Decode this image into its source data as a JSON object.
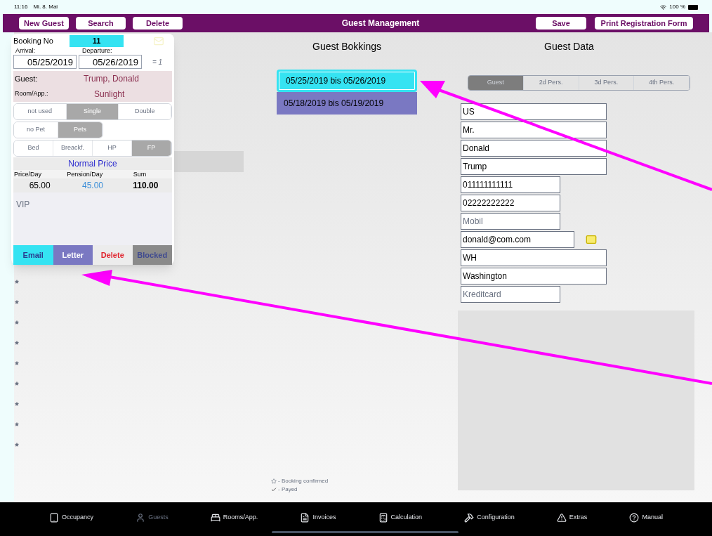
{
  "status_bar": {
    "time": "11:16",
    "date": "Mi. 8. Mai",
    "battery": "100 %"
  },
  "toolbar": {
    "title": "Guest Management",
    "left_buttons": [
      "New Guest",
      "Search",
      "Delete"
    ],
    "right_buttons": [
      "Save",
      "Print Registration Form"
    ]
  },
  "booking_card": {
    "booking_no_label": "Booking No",
    "booking_no": "11",
    "arrival_label": "Arrival:",
    "departure_label": "Departure:",
    "arrival": "05/25/2019",
    "departure": "05/26/2019",
    "nights": "= 1",
    "guest_label": "Guest:",
    "guest": "Trump, Donald",
    "room_label": "Room/App.:",
    "room": "Sunlight",
    "occupancy": [
      {
        "label": "not used",
        "selected": false
      },
      {
        "label": "Single",
        "selected": true
      },
      {
        "label": "Double",
        "selected": false
      }
    ],
    "pets": [
      {
        "label": "no Pet",
        "selected": false
      },
      {
        "label": "Pets",
        "selected": true
      }
    ],
    "board": [
      {
        "label": "Bed",
        "selected": false
      },
      {
        "label": "Breackf.",
        "selected": false
      },
      {
        "label": "HP",
        "selected": false
      },
      {
        "label": "FP",
        "selected": true
      }
    ],
    "price_type": "Normal Price",
    "price_labels": [
      "Price/Day",
      "Pension/Day",
      "Sum"
    ],
    "prices": [
      "65.00",
      "45.00",
      "110.00"
    ],
    "note": "VIP",
    "actions": [
      {
        "label": "Email",
        "kind": "email"
      },
      {
        "label": "Letter",
        "kind": "letter"
      },
      {
        "label": "Delete",
        "kind": "delete"
      },
      {
        "label": "Blocked",
        "kind": "blocked"
      }
    ]
  },
  "legend": [
    {
      "kind": "star",
      "text": "- Booking confirmed"
    },
    {
      "kind": "check",
      "text": "- Payed"
    }
  ],
  "bookings": {
    "title": "Guest Bokkings",
    "items": [
      {
        "label": "05/25/2019  bis  05/26/2019",
        "selected": true
      },
      {
        "label": "05/18/2019  bis  05/19/2019",
        "selected": false
      }
    ]
  },
  "guest_data": {
    "title": "Guest Data",
    "person_tabs": [
      {
        "label": "Guest",
        "selected": true
      },
      {
        "label": "2d Pers.",
        "selected": false
      },
      {
        "label": "3d Pers.",
        "selected": false
      },
      {
        "label": "4th Pers.",
        "selected": false
      }
    ],
    "fields": [
      {
        "value": "US",
        "kind": "wide"
      },
      {
        "value": "Mr.",
        "kind": "wide"
      },
      {
        "value": "Donald",
        "kind": "wide"
      },
      {
        "value": "Trump",
        "kind": "wide"
      },
      {
        "value": "011111111111",
        "kind": "narrow"
      },
      {
        "value": "02222222222",
        "kind": "narrow"
      },
      {
        "placeholder": "Mobil",
        "kind": "narrow"
      },
      {
        "value": "donald@com.com",
        "kind": "email"
      },
      {
        "value": "WH",
        "kind": "wide"
      },
      {
        "value": "Washington",
        "kind": "wide"
      },
      {
        "placeholder": "Kreditcard",
        "kind": "narrow"
      }
    ]
  },
  "tab_bar": [
    {
      "label": "Occupancy",
      "selected": false
    },
    {
      "label": "Guests",
      "selected": true
    },
    {
      "label": "Rooms/App.",
      "selected": false
    },
    {
      "label": "Invoices",
      "selected": false
    },
    {
      "label": "Calculation",
      "selected": false
    },
    {
      "label": "Configuration",
      "selected": false
    },
    {
      "label": "Extras",
      "selected": false
    },
    {
      "label": "Manual",
      "selected": false
    }
  ]
}
